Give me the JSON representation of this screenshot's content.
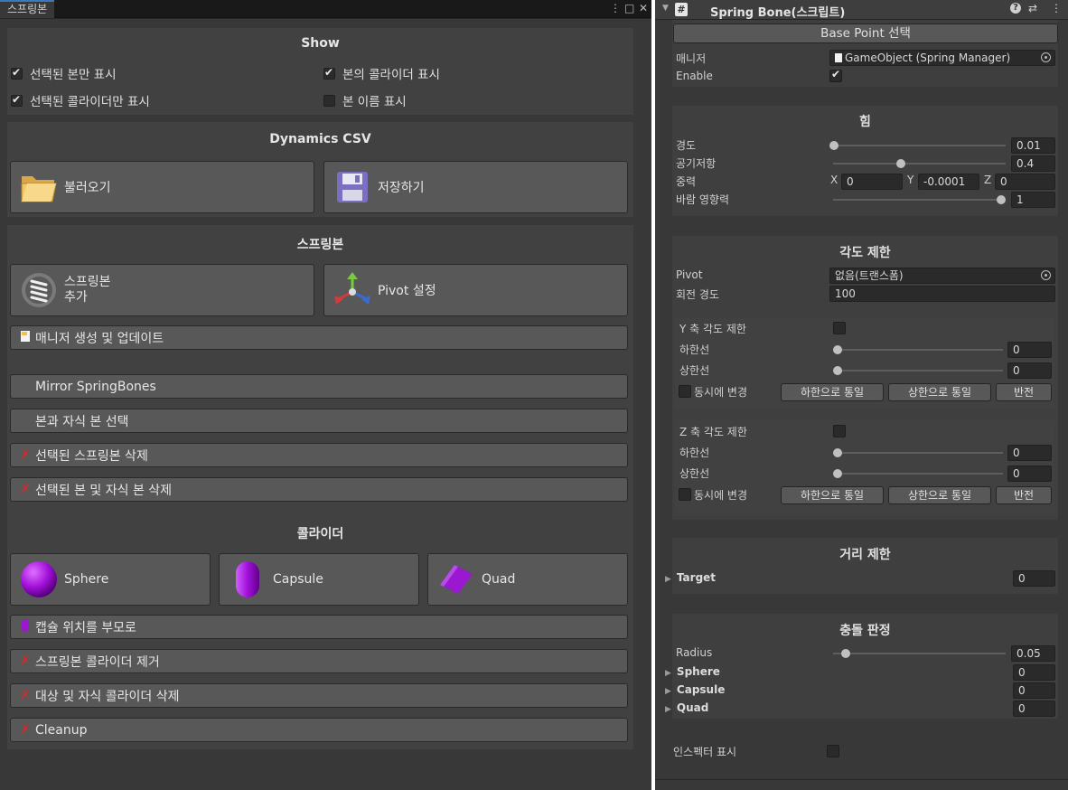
{
  "left": {
    "tab_title": "스프링본",
    "controls": {
      "menu": "⋮",
      "maximize": "□",
      "close": "✕"
    },
    "show": {
      "title": "Show",
      "toggles": [
        {
          "label": "선택된 본만 표시",
          "checked": true
        },
        {
          "label": "본의 콜라이더 표시",
          "checked": true
        },
        {
          "label": "선택된 콜라이더만 표시",
          "checked": true
        },
        {
          "label": "본 이름 표시",
          "checked": false
        }
      ]
    },
    "dynamics": {
      "title": "Dynamics CSV",
      "load": "불러오기",
      "save": "저장하기"
    },
    "springbone": {
      "title": "스프링본",
      "add_line1": "스프링본",
      "add_line2": "추가",
      "pivot": "Pivot 설정",
      "manager": "매니저 생성 및 업데이트",
      "mirror": "Mirror SpringBones",
      "select_children": "본과 자식 본 선택",
      "delete_selected": "선택된 스프링본 삭제",
      "delete_children": "선택된 본 및 자식 본 삭제"
    },
    "collider": {
      "title": "콜라이더",
      "sphere": "Sphere",
      "capsule": "Capsule",
      "quad": "Quad",
      "capsule_to_parent": "캡슐 위치를 부모로",
      "remove_collider": "스프링본 콜라이더 제거",
      "delete_target_children": "대상 및 자식 콜라이더 삭제",
      "cleanup": "Cleanup"
    }
  },
  "right": {
    "header": {
      "title": "Spring Bone(스크립트)",
      "hash": "#"
    },
    "base_point_button": "Base Point 선택",
    "manager_label": "매니저",
    "manager_value": "GameObject (Spring Manager)",
    "enable_label": "Enable",
    "enable_checked": true,
    "force": {
      "title": "힘",
      "stiffness_label": "경도",
      "stiffness_value": "0.01",
      "stiffness_level": 0.0,
      "drag_label": "공기저항",
      "drag_value": "0.4",
      "drag_level": 0.4,
      "gravity_label": "중력",
      "gx_label": "X",
      "gx": "0",
      "gy_label": "Y",
      "gy": "-0.0001",
      "gz_label": "Z",
      "gz": "0",
      "wind_label": "바람 영향력",
      "wind_value": "1",
      "wind_level": 1.0
    },
    "angle": {
      "title": "각도 제한",
      "pivot_label": "Pivot",
      "pivot_value": "없음(트랜스폼)",
      "rot_stiff_label": "회전 경도",
      "rot_stiff_value": "100",
      "y_title": "Y 축 각도 제한",
      "y_enabled": false,
      "lower_label": "하한선",
      "upper_label": "상한선",
      "y_lower": "0",
      "y_upper": "0",
      "sync_label": "동시에 변경",
      "btn_lower": "하한으로 통일",
      "btn_upper": "상한으로 통일",
      "btn_invert": "반전",
      "z_title": "Z 축 각도 제한",
      "z_enabled": false,
      "z_lower": "0",
      "z_upper": "0"
    },
    "distance": {
      "title": "거리 제한",
      "target_label": "Target",
      "target_value": "0"
    },
    "collision": {
      "title": "충돌 판정",
      "radius_label": "Radius",
      "radius_value": "0.05",
      "radius_level": 0.05,
      "sphere_label": "Sphere",
      "sphere_value": "0",
      "capsule_label": "Capsule",
      "capsule_value": "0",
      "quad_label": "Quad",
      "quad_value": "0"
    },
    "inspector_label": "인스펙터 표시",
    "inspector_checked": false
  }
}
